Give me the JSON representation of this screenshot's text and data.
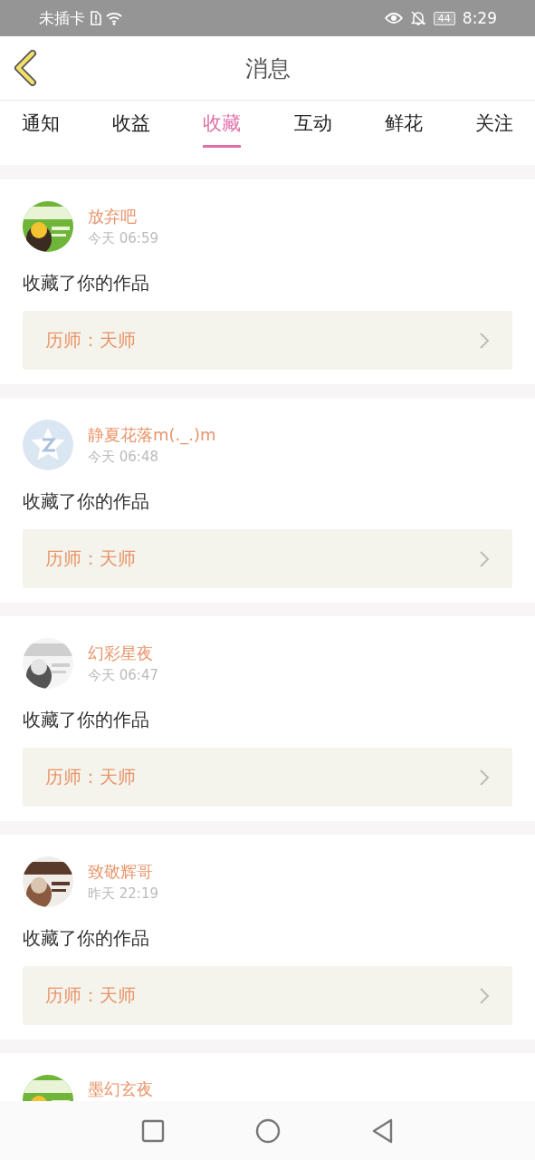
{
  "status_bar": {
    "carrier": "未插卡",
    "battery": "44",
    "time": "8:29"
  },
  "header": {
    "title": "消息"
  },
  "tabs": [
    {
      "label": "通知",
      "selected": false
    },
    {
      "label": "收益",
      "selected": false
    },
    {
      "label": "收藏",
      "selected": true
    },
    {
      "label": "互动",
      "selected": false
    },
    {
      "label": "鲜花",
      "selected": false
    },
    {
      "label": "关注",
      "selected": false
    }
  ],
  "items": [
    {
      "kind": "picture",
      "name": "放弃吧",
      "time": "今天 06:59",
      "action": "收藏了你的作品",
      "work": "历师：天师"
    },
    {
      "kind": "default",
      "name": "静夏花落m(._.)m",
      "time": "今天 06:48",
      "action": "收藏了你的作品",
      "work": "历师：天师"
    },
    {
      "kind": "picture",
      "name": "幻彩星夜",
      "time": "今天 06:47",
      "action": "收藏了你的作品",
      "work": "历师：天师"
    },
    {
      "kind": "picture",
      "name": "致敬辉哥",
      "time": "昨天 22:19",
      "action": "收藏了你的作品",
      "work": "历师：天师"
    },
    {
      "kind": "picture",
      "name": "墨幻玄夜"
    }
  ]
}
